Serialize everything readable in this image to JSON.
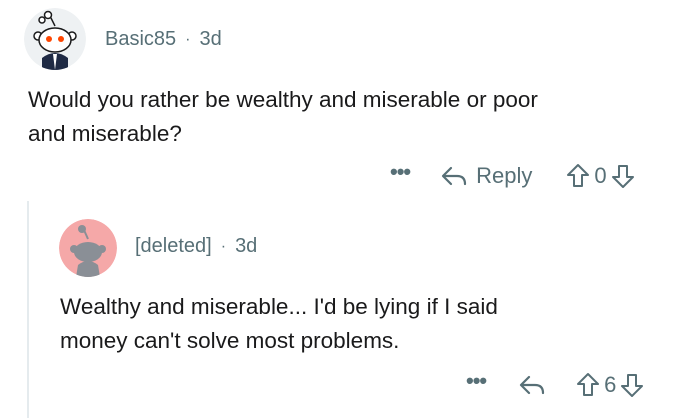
{
  "comments": [
    {
      "username": "Basic85",
      "separator": "·",
      "age": "3d",
      "text_lines": [
        "Would you rather be wealthy and miserable or poor",
        "and miserable?"
      ],
      "more_label": "•••",
      "reply_label": "Reply",
      "score": "0",
      "avatar_icon": "snoo-avatar-icon"
    },
    {
      "username": "[deleted]",
      "separator": "·",
      "age": "3d",
      "text_lines": [
        "Wealthy and miserable... I'd be lying if I said",
        "money can't solve most problems."
      ],
      "more_label": "•••",
      "score": "6",
      "avatar_icon": "deleted-snoo-avatar-icon"
    }
  ],
  "colors": {
    "meta_text": "#576f76",
    "body_text": "#1a1a1b",
    "thread_line": "#e5ebee",
    "deleted_avatar_bg": "#f5a8a8"
  }
}
